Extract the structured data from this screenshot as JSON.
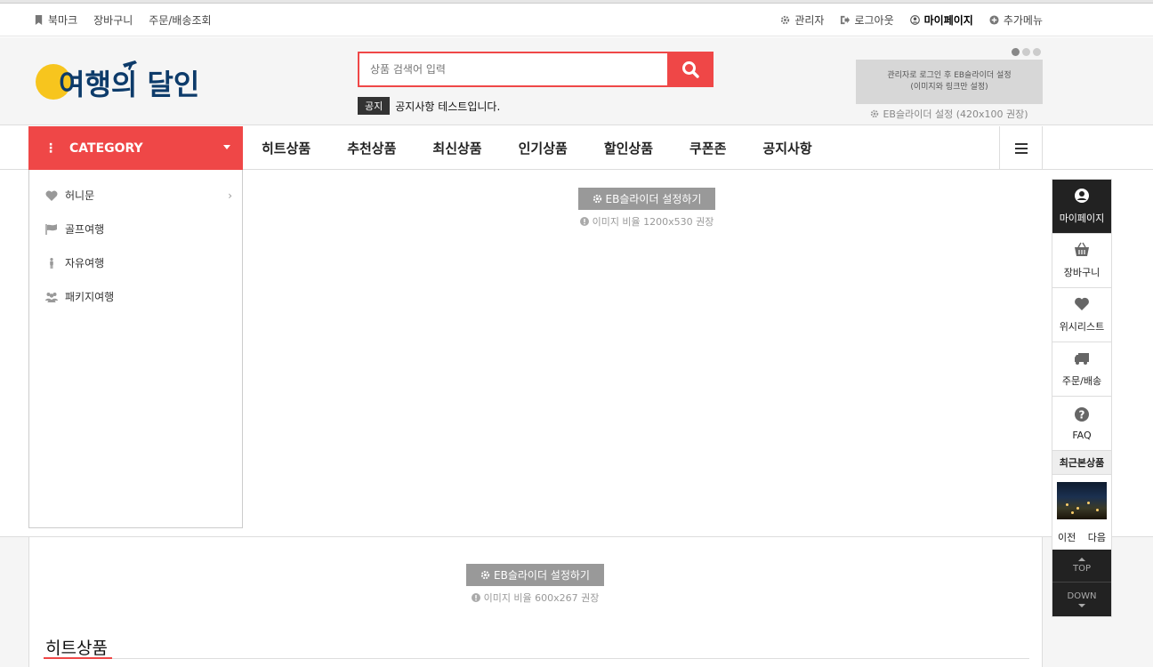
{
  "topbar": {
    "left": [
      "북마크",
      "장바구니",
      "주문/배송조회"
    ],
    "right": [
      "관리자",
      "로그아웃",
      "마이페이지",
      "추가메뉴"
    ]
  },
  "header": {
    "logo_text": "여행의 달인",
    "search_placeholder": "상품 검색어 입력",
    "notice_tag": "공지",
    "notice_text": "공지사항 테스트입니다.",
    "banner_line1": "관리자로 로그인 후 EB슬라이더 설정",
    "banner_line2": "(이미지와 링크만 설정)",
    "banner_caption": "EB슬라이더 설정 (420x100 권장)"
  },
  "nav": {
    "category_label": "CATEGORY",
    "menu": [
      "히트상품",
      "추천상품",
      "최신상품",
      "인기상품",
      "할인상품",
      "쿠폰존",
      "공지사항"
    ]
  },
  "categories": [
    {
      "label": "허니문",
      "icon": "heart-icon"
    },
    {
      "label": "골프여행",
      "icon": "flag-icon"
    },
    {
      "label": "자유여행",
      "icon": "person-icon"
    },
    {
      "label": "패키지여행",
      "icon": "group-icon"
    }
  ],
  "main_slider": {
    "button": "EB슬라이더 설정하기",
    "note": "이미지 비율 1200x530 권장"
  },
  "lower_slider": {
    "button": "EB슬라이더 설정하기",
    "note": "이미지 비율 600x267 권장"
  },
  "section": {
    "title": "히트상품"
  },
  "quick_menu": {
    "items": [
      "마이페이지",
      "장바구니",
      "위시리스트",
      "주문/배송",
      "FAQ"
    ],
    "recent": "최근본상품",
    "prev": "이전",
    "next": "다음",
    "top": "TOP",
    "down": "DOWN"
  },
  "colors": {
    "accent": "#ef4747",
    "dark": "#222222"
  }
}
